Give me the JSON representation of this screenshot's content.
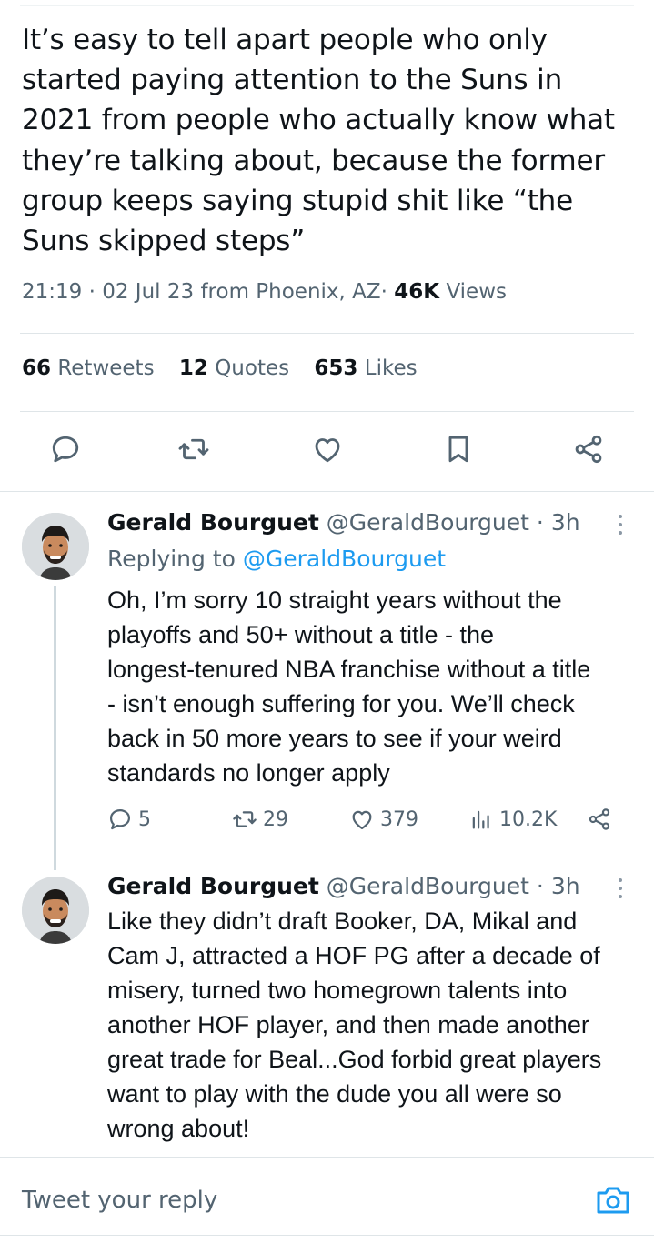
{
  "tweet": {
    "text": "It’s easy to tell apart people who only\nstarted paying attention to the Suns in\n2021 from people who actually know what\nthey’re talking about, because the former\ngroup keeps saying stupid shit like “the\nSuns skipped steps”",
    "time": "21:19",
    "date": "02 Jul 23",
    "location": "from Phoenix, AZ",
    "views_count": "46K",
    "views_label": "Views",
    "sep": "·"
  },
  "stats": {
    "retweets_count": "66",
    "retweets_label": "Retweets",
    "quotes_count": "12",
    "quotes_label": "Quotes",
    "likes_count": "653",
    "likes_label": "Likes"
  },
  "actions": [
    "reply-icon",
    "retweet-icon",
    "like-icon",
    "bookmark-icon",
    "share-icon"
  ],
  "replies": [
    {
      "name": "Gerald Bourguet",
      "handle": "@GeraldBourguet",
      "age": "· 3h",
      "replying_prefix": "Replying to ",
      "replying_to": "@GeraldBourguet",
      "text": "Oh, I’m sorry 10 straight years without the\nplayoffs and 50+ without a title - the\nlongest-tenured NBA franchise without a title\n- isn’t enough suffering for you. We’ll check\nback in 50 more years to see if your weird\nstandards no longer apply",
      "reply_count": "5",
      "retweet_count": "29",
      "like_count": "379",
      "views_count": "10.2K"
    },
    {
      "name": "Gerald Bourguet",
      "handle": "@GeraldBourguet",
      "age": "· 3h",
      "text": "Like they didn’t draft Booker, DA, Mikal and\nCam J, attracted a HOF PG after a decade of\nmisery, turned two homegrown talents into\nanother HOF player, and then made another\ngreat trade for Beal...God forbid great players\nwant to play with the dude you all were so\nwrong about!"
    }
  ],
  "composer": {
    "placeholder": "Tweet your reply"
  },
  "colors": {
    "accent": "#1d9bf0",
    "secondary_text": "#536471",
    "primary_text": "#0f1419"
  }
}
